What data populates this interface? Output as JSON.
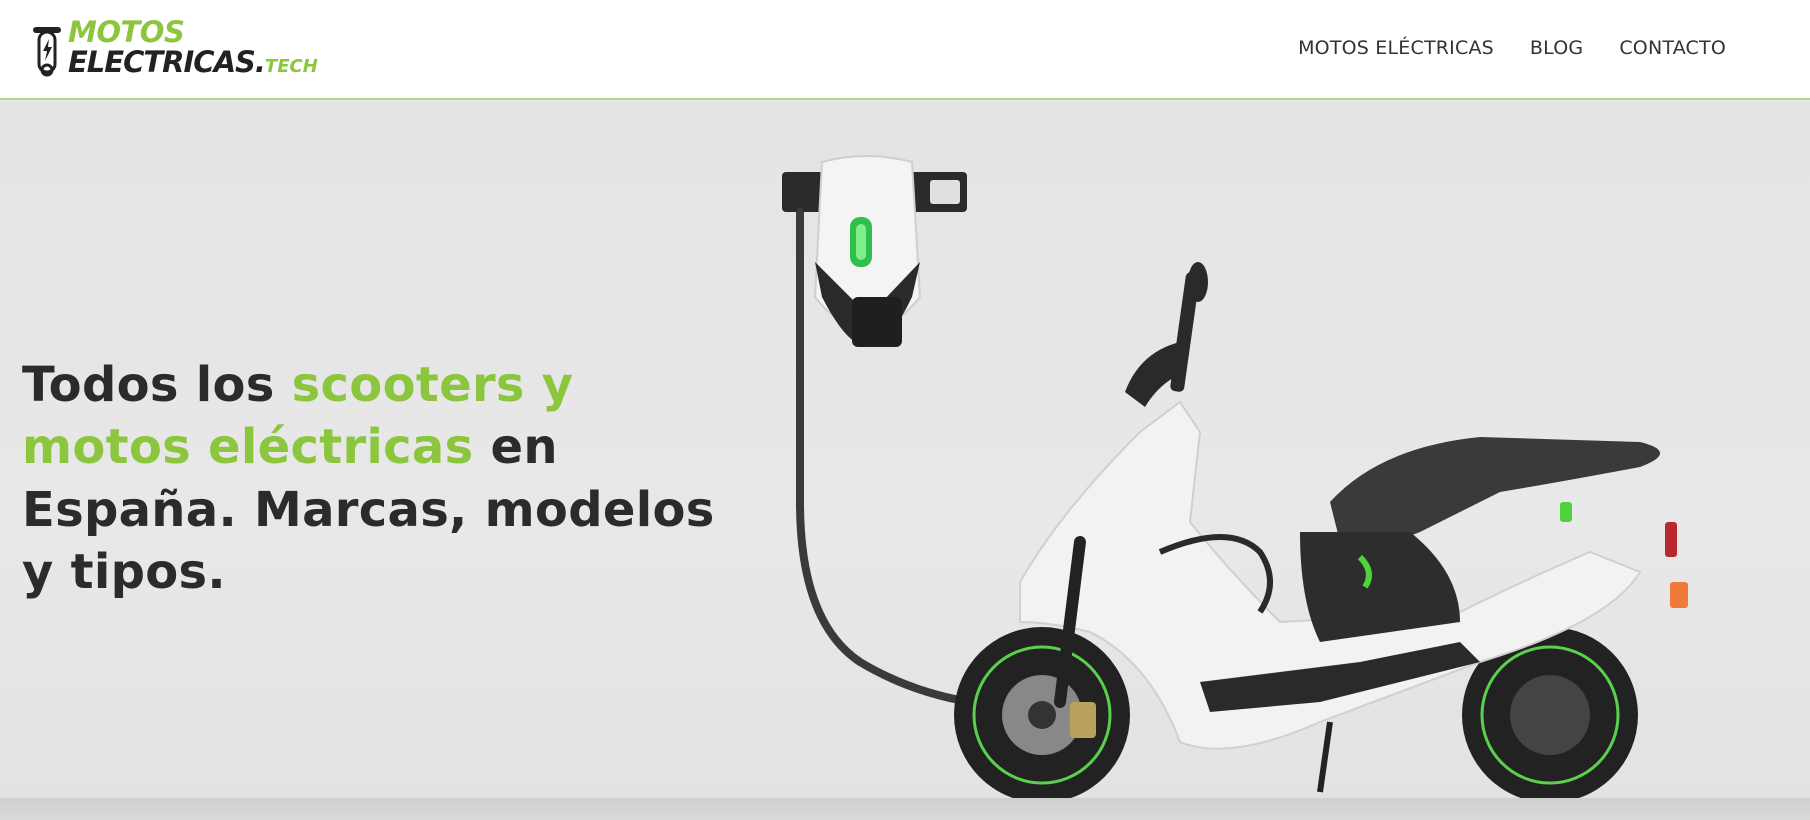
{
  "brand": {
    "line1": "MOTOS",
    "line2": "ELECTRICAS.",
    "tld": "TECH",
    "accent_color": "#8cc63f",
    "dark_color": "#222222",
    "icon": "scooter-bolt-icon"
  },
  "nav": {
    "items": [
      {
        "label": "MOTOS ELÉCTRICAS"
      },
      {
        "label": "BLOG"
      },
      {
        "label": "CONTACTO"
      }
    ]
  },
  "hero": {
    "title_part1": "Todos los ",
    "title_highlight1": "scooters y motos eléctricas",
    "title_part2": " en España. Marcas, modelos y tipos.",
    "image": "electric-scooter-charging-image"
  }
}
